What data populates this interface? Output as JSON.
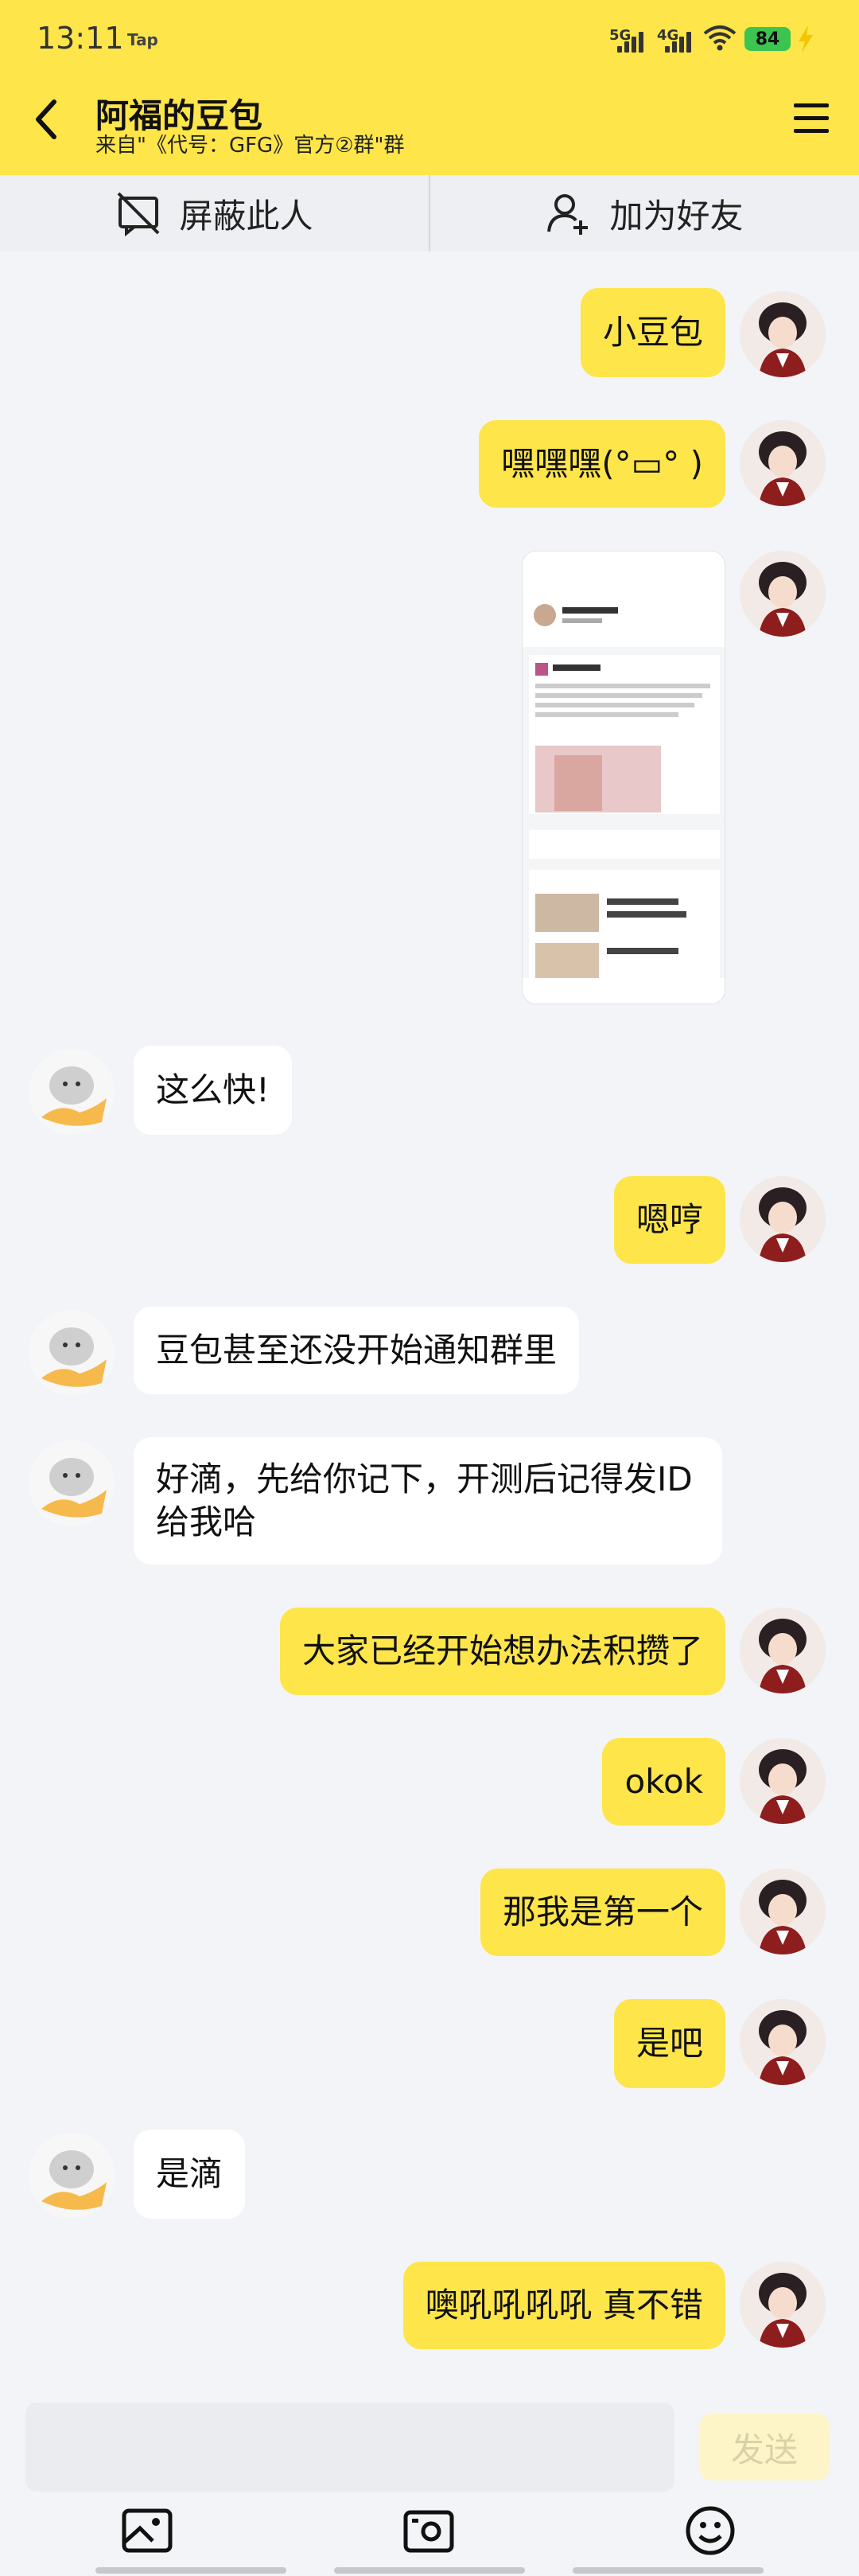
{
  "status": {
    "time": "13:11",
    "app_tag": "Tap",
    "network1": "5G",
    "network2": "4G",
    "battery": "84"
  },
  "header": {
    "title": "阿福的豆包",
    "subtitle": "来自\"《代号：GFG》官方②群\"群"
  },
  "actions": {
    "block_label": "屏蔽此人",
    "add_friend_label": "加为好友"
  },
  "messages": [
    {
      "from": "me",
      "text": "小豆包"
    },
    {
      "from": "me",
      "text": "嘿嘿嘿(°▭° )"
    },
    {
      "from": "me",
      "type": "image"
    },
    {
      "from": "other",
      "text": "这么快!"
    },
    {
      "from": "me",
      "text": "嗯哼"
    },
    {
      "from": "other",
      "text": "豆包甚至还没开始通知群里"
    },
    {
      "from": "other",
      "text": "好滴，先给你记下，开测后记得发ID给我哈"
    },
    {
      "from": "me",
      "text": "大家已经开始想办法积攒了"
    },
    {
      "from": "me",
      "text": "okok"
    },
    {
      "from": "me",
      "text": "那我是第一个"
    },
    {
      "from": "me",
      "text": "是吧"
    },
    {
      "from": "other",
      "text": "是滴"
    },
    {
      "from": "me",
      "text": "噢吼吼吼吼 真不错"
    }
  ],
  "input": {
    "placeholder": "",
    "send_label": "发送"
  },
  "colors": {
    "accent": "#fde54a",
    "background": "#f3f4f8",
    "bubble_other": "#ffffff"
  },
  "icons": [
    "back-arrow-icon",
    "menu-icon",
    "block-icon",
    "add-friend-icon",
    "image-icon",
    "camera-icon",
    "emoji-icon"
  ]
}
